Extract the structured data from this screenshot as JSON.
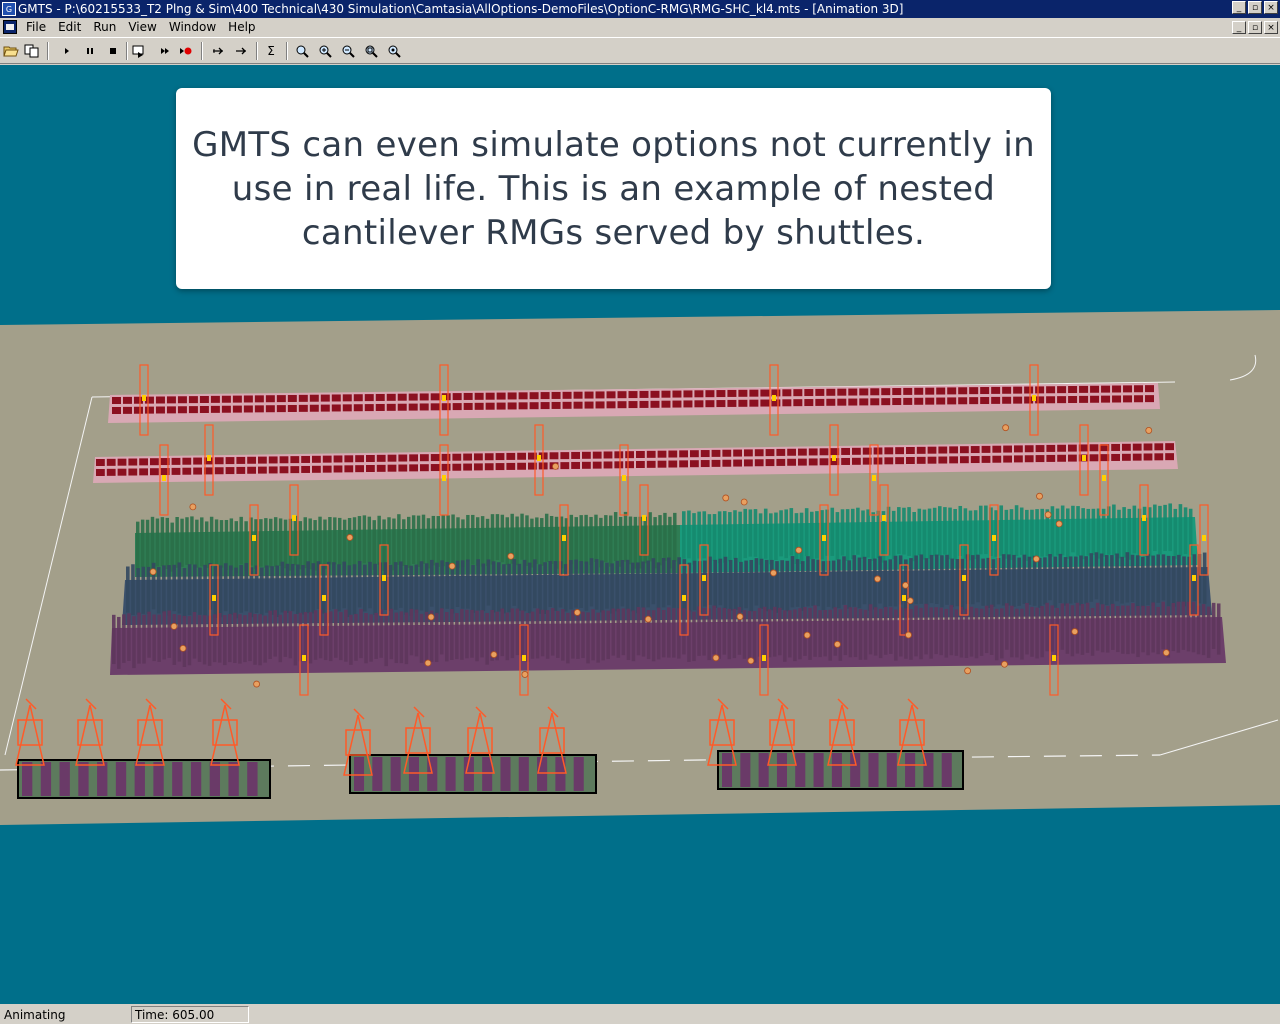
{
  "window": {
    "title": "GMTS - P:\\60215533_T2 Plng & Sim\\400 Technical\\430 Simulation\\Camtasia\\AllOptions-DemoFiles\\OptionC-RMG\\RMG-SHC_kl4.mts - [Animation 3D]",
    "controls": [
      "_",
      "▫",
      "×"
    ]
  },
  "menu": {
    "items": [
      "File",
      "Edit",
      "Run",
      "View",
      "Window",
      "Help"
    ]
  },
  "toolbar": {
    "buttons": [
      "open-icon",
      "copy-icon",
      "play-icon",
      "pause-icon",
      "stop-icon",
      "step-icon",
      "fast-forward-icon",
      "record-icon",
      "jump-back-icon",
      "jump-forward-icon",
      "sigma-icon",
      "zoom-1-icon",
      "zoom-2-icon",
      "zoom-3-icon",
      "zoom-4-icon",
      "zoom-5-icon"
    ],
    "sigma": "Σ"
  },
  "callout": {
    "text": "GMTS can even simulate options not currently in use in real life. This is an example of nested cantilever RMGs served by shuttles."
  },
  "status": {
    "state": "Animating",
    "time": "Time: 605.00"
  },
  "colors": {
    "water": "#006f8a",
    "quay": "#a39f8a",
    "block_green": "#2f7d54",
    "block_teal": "#1a9a7c",
    "block_blue": "#3a506b",
    "block_purple": "#6c3f6a",
    "rail_red": "#8b1020",
    "crane_orange": "#ff5a28",
    "vessel_purple": "#6a3a68"
  }
}
